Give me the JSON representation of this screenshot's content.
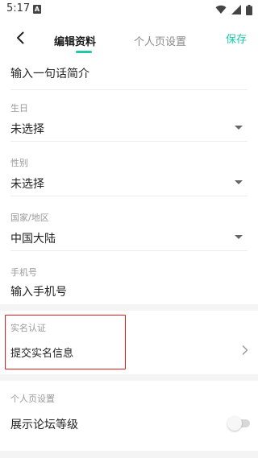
{
  "status_bar": {
    "time": "5:17",
    "notification_glyph": "A",
    "icons": [
      "wifi-icon",
      "cell-signal-icon",
      "battery-icon"
    ]
  },
  "nav": {
    "back_icon": "chevron-left-icon",
    "tabs": [
      {
        "label": "编辑资料",
        "active": true
      },
      {
        "label": "个人页设置",
        "active": false
      }
    ],
    "save_label": "保存",
    "accent_color": "#1fc8a9"
  },
  "form": {
    "bio": {
      "placeholder": "输入一句话简介"
    },
    "birthday": {
      "label": "生日",
      "value": "未选择"
    },
    "gender": {
      "label": "性别",
      "value": "未选择"
    },
    "region": {
      "label": "国家/地区",
      "value": "中国大陆"
    },
    "phone": {
      "label": "手机号",
      "placeholder": "输入手机号"
    },
    "real_name": {
      "label": "实名认证",
      "value": "提交实名信息"
    }
  },
  "profile_settings": {
    "section_label": "个人页设置",
    "forum_level": {
      "label": "展示论坛等级",
      "enabled": false
    }
  },
  "highlight_color": "#e21b1b"
}
